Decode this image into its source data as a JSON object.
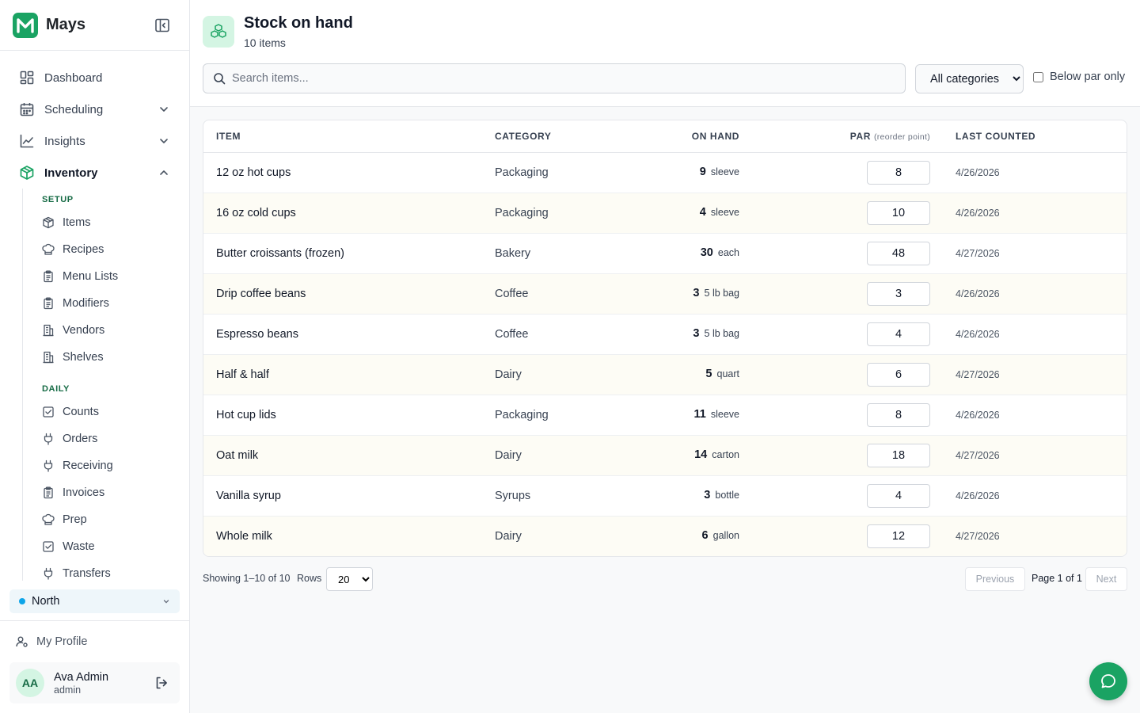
{
  "app": {
    "name": "Mays",
    "accent": "#1aa363"
  },
  "sidebar": {
    "nav": [
      {
        "label": "Dashboard",
        "icon": "grid-icon"
      },
      {
        "label": "Scheduling",
        "icon": "calendar-icon"
      },
      {
        "label": "Insights",
        "icon": "chart-line-icon"
      },
      {
        "label": "Inventory",
        "icon": "box-icon"
      }
    ],
    "setup_label": "SETUP",
    "setup_items": [
      {
        "label": "Items",
        "icon": "box-icon"
      },
      {
        "label": "Recipes",
        "icon": "chef-hat-icon"
      },
      {
        "label": "Menu Lists",
        "icon": "clipboard-icon"
      },
      {
        "label": "Modifiers",
        "icon": "clipboard-icon"
      },
      {
        "label": "Vendors",
        "icon": "building-icon"
      },
      {
        "label": "Shelves",
        "icon": "building-icon"
      }
    ],
    "daily_label": "DAILY",
    "daily_items": [
      {
        "label": "Counts",
        "icon": "check-square-icon"
      },
      {
        "label": "Orders",
        "icon": "plug-icon"
      },
      {
        "label": "Receiving",
        "icon": "plug-icon"
      },
      {
        "label": "Invoices",
        "icon": "clipboard-icon"
      },
      {
        "label": "Prep",
        "icon": "chef-hat-icon"
      },
      {
        "label": "Waste",
        "icon": "check-square-icon"
      },
      {
        "label": "Transfers",
        "icon": "plug-icon"
      }
    ],
    "store": {
      "name": "North",
      "dot_color": "#0ea5e9"
    },
    "profile_link": "My Profile",
    "user": {
      "initials": "AA",
      "name": "Ava Admin",
      "role": "admin"
    }
  },
  "header": {
    "title": "Stock on hand",
    "subtitle": "10 items",
    "search_placeholder": "Search items...",
    "category_selected": "All categories",
    "below_par_label": "Below par only"
  },
  "table": {
    "columns": {
      "item": "ITEM",
      "category": "CATEGORY",
      "on_hand": "ON HAND",
      "par": "PAR",
      "par_note": "(reorder point)",
      "last_counted": "LAST COUNTED"
    },
    "rows": [
      {
        "item": "12 oz hot cups",
        "category": "Packaging",
        "qty": "9",
        "unit": "sleeve",
        "par": "8",
        "date": "4/26/2026"
      },
      {
        "item": "16 oz cold cups",
        "category": "Packaging",
        "qty": "4",
        "unit": "sleeve",
        "par": "10",
        "date": "4/26/2026"
      },
      {
        "item": "Butter croissants (frozen)",
        "category": "Bakery",
        "qty": "30",
        "unit": "each",
        "par": "48",
        "date": "4/27/2026"
      },
      {
        "item": "Drip coffee beans",
        "category": "Coffee",
        "qty": "3",
        "unit": "5 lb bag",
        "par": "3",
        "date": "4/26/2026"
      },
      {
        "item": "Espresso beans",
        "category": "Coffee",
        "qty": "3",
        "unit": "5 lb bag",
        "par": "4",
        "date": "4/26/2026"
      },
      {
        "item": "Half & half",
        "category": "Dairy",
        "qty": "5",
        "unit": "quart",
        "par": "6",
        "date": "4/27/2026"
      },
      {
        "item": "Hot cup lids",
        "category": "Packaging",
        "qty": "11",
        "unit": "sleeve",
        "par": "8",
        "date": "4/26/2026"
      },
      {
        "item": "Oat milk",
        "category": "Dairy",
        "qty": "14",
        "unit": "carton",
        "par": "18",
        "date": "4/27/2026"
      },
      {
        "item": "Vanilla syrup",
        "category": "Syrups",
        "qty": "3",
        "unit": "bottle",
        "par": "4",
        "date": "4/26/2026"
      },
      {
        "item": "Whole milk",
        "category": "Dairy",
        "qty": "6",
        "unit": "gallon",
        "par": "12",
        "date": "4/27/2026"
      }
    ]
  },
  "footer": {
    "showing": "Showing 1–10 of 10",
    "rows_label": "Rows",
    "rows_value": "20",
    "previous": "Previous",
    "page_text": "Page 1 of 1",
    "next": "Next"
  },
  "fab": {
    "icon": "chat-icon"
  }
}
